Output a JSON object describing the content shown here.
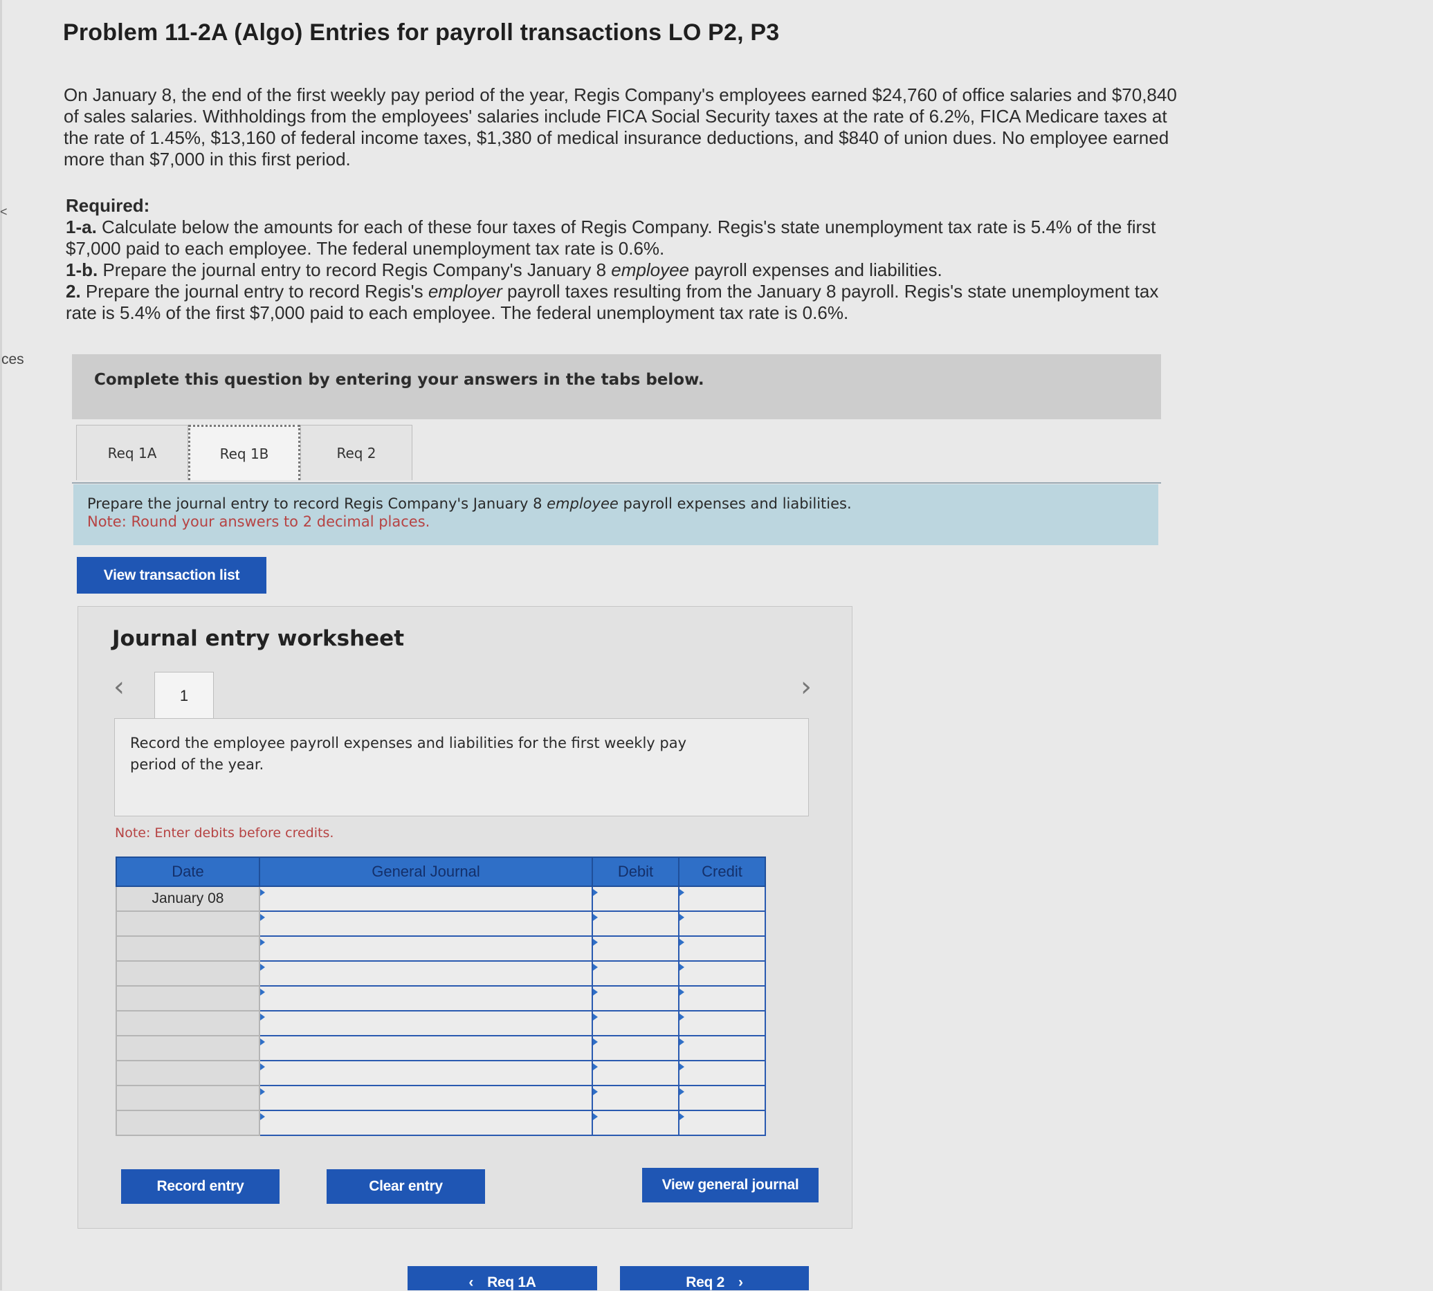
{
  "sidebar": {
    "edge_label": "ces",
    "edge_mark": "<"
  },
  "problem": {
    "title": "Problem 11-2A (Algo) Entries for payroll transactions LO P2, P3",
    "intro": "On January 8, the end of the first weekly pay period of the year, Regis Company's employees earned $24,760 of office salaries and $70,840 of sales salaries. Withholdings from the employees' salaries include FICA Social Security taxes at the rate of 6.2%, FICA Medicare taxes at the rate of 1.45%, $13,160 of federal income taxes, $1,380 of medical insurance deductions, and $840 of union dues. No employee earned more than $7,000 in this first period.",
    "required_heading": "Required:",
    "req_1a_label": "1-a.",
    "req_1a_text": "Calculate below the amounts for each of these four taxes of Regis Company. Regis's state unemployment tax rate is 5.4% of the first $7,000 paid to each employee. The federal unemployment tax rate is 0.6%.",
    "req_1b_label": "1-b.",
    "req_1b_pre": "Prepare the journal entry to record Regis Company's January 8",
    "req_1b_em": "employee",
    "req_1b_post": "payroll expenses and liabilities.",
    "req_2_label": "2.",
    "req_2_pre": "Prepare the journal entry to record Regis's",
    "req_2_em": "employer",
    "req_2_post": "payroll taxes resulting from the January 8 payroll. Regis's state unemployment tax rate is 5.4% of the first $7,000 paid to each employee. The federal unemployment tax rate is 0.6%."
  },
  "instructions": "Complete this question by entering your answers in the tabs below.",
  "tabs": [
    {
      "label": "Req 1A",
      "active": false
    },
    {
      "label": "Req 1B",
      "active": true
    },
    {
      "label": "Req 2",
      "active": false
    }
  ],
  "prompt": {
    "pre": "Prepare the journal entry to record Regis Company's January 8",
    "em": "employee",
    "post": "payroll expenses and liabilities.",
    "note": "Note: Round your answers to 2 decimal places."
  },
  "buttons": {
    "view_transaction_list": "View transaction list",
    "record_entry": "Record entry",
    "clear_entry": "Clear entry",
    "view_general_journal": "View general journal",
    "prev_req": "Req 1A",
    "next_req": "Req 2"
  },
  "worksheet": {
    "title": "Journal entry worksheet",
    "page": "1",
    "description": "Record the employee payroll expenses and liabilities for the first weekly pay period of the year.",
    "note": "Note: Enter debits before credits.",
    "columns": [
      "Date",
      "General Journal",
      "Debit",
      "Credit"
    ],
    "rows": [
      {
        "date": "January 08",
        "account": "",
        "debit": "",
        "credit": ""
      },
      {
        "date": "",
        "account": "",
        "debit": "",
        "credit": ""
      },
      {
        "date": "",
        "account": "",
        "debit": "",
        "credit": ""
      },
      {
        "date": "",
        "account": "",
        "debit": "",
        "credit": ""
      },
      {
        "date": "",
        "account": "",
        "debit": "",
        "credit": ""
      },
      {
        "date": "",
        "account": "",
        "debit": "",
        "credit": ""
      },
      {
        "date": "",
        "account": "",
        "debit": "",
        "credit": ""
      },
      {
        "date": "",
        "account": "",
        "debit": "",
        "credit": ""
      },
      {
        "date": "",
        "account": "",
        "debit": "",
        "credit": ""
      },
      {
        "date": "",
        "account": "",
        "debit": "",
        "credit": ""
      }
    ]
  },
  "icons": {
    "prev": "chevron-left-icon",
    "next": "chevron-right-icon"
  },
  "colors": {
    "primary_button": "#1f56b4",
    "table_header": "#2f6fc7",
    "prompt_bg": "#bcd6df",
    "note_red": "#b64343"
  }
}
